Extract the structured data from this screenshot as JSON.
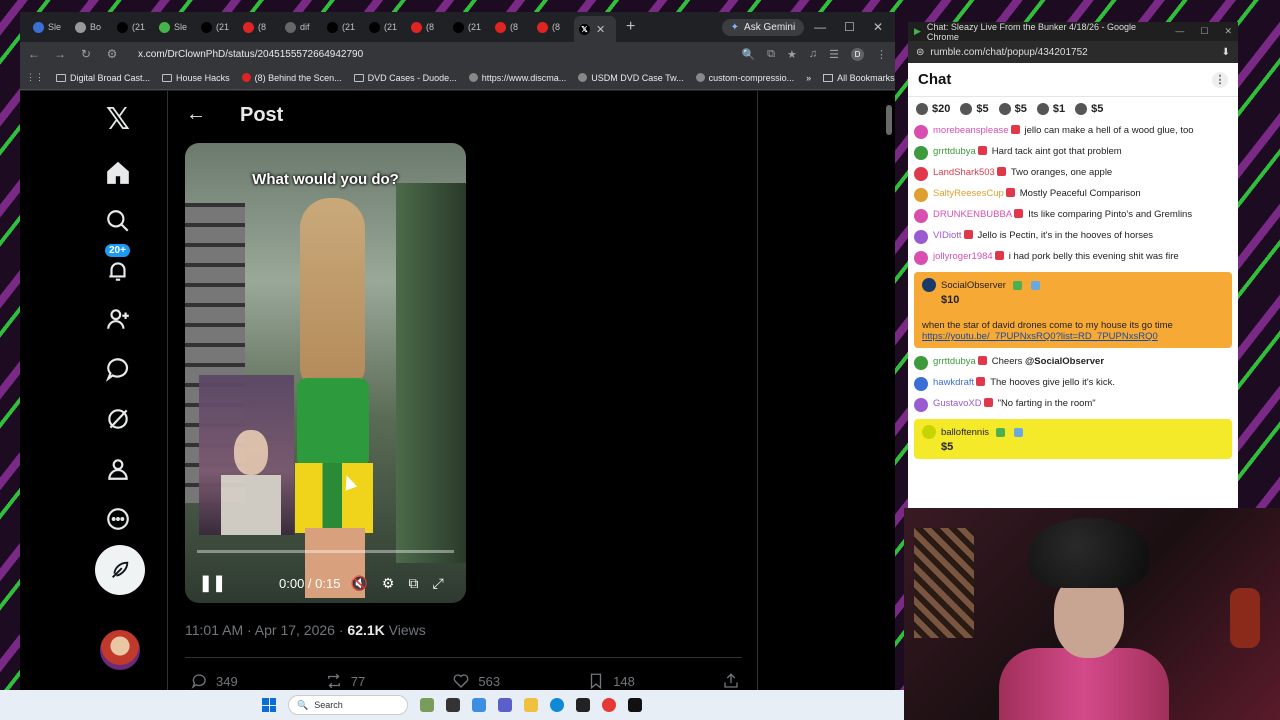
{
  "left_browser": {
    "tabs": [
      {
        "label": "Sle",
        "icon": "rumble-icon",
        "color": "#3b6fd6"
      },
      {
        "label": "Bo",
        "icon": "star-icon",
        "color": "#999999"
      },
      {
        "label": "(21",
        "icon": "x-icon",
        "color": "#000000"
      },
      {
        "label": "Sle",
        "icon": "rumble-icon",
        "color": "#46b34b"
      },
      {
        "label": "(21",
        "icon": "x-icon",
        "color": "#000000"
      },
      {
        "label": "(8",
        "icon": "youtube-icon",
        "color": "#e02424"
      },
      {
        "label": "dif",
        "icon": "web-icon",
        "color": "#666666"
      },
      {
        "label": "(21",
        "icon": "x-icon",
        "color": "#000000"
      },
      {
        "label": "(21",
        "icon": "x-icon",
        "color": "#000000"
      },
      {
        "label": "(8",
        "icon": "youtube-icon",
        "color": "#e02424"
      },
      {
        "label": "(21",
        "icon": "x-icon",
        "color": "#000000"
      },
      {
        "label": "(8",
        "icon": "youtube-icon",
        "color": "#e02424"
      },
      {
        "label": "(8",
        "icon": "youtube-icon",
        "color": "#e02424"
      }
    ],
    "active_tab_icon": "x-icon",
    "ask_gemini": "Ask Gemini",
    "url": "x.com/DrClownPhD/status/2045155572664942790",
    "bookmarks": [
      {
        "label": "Digital Broad Cast...",
        "icon": "folder-icon"
      },
      {
        "label": "House Hacks",
        "icon": "folder-icon"
      },
      {
        "label": "(8) Behind the Scen...",
        "icon": "youtube-icon"
      },
      {
        "label": "DVD Cases - Duode...",
        "icon": "folder-icon"
      },
      {
        "label": "https://www.discma...",
        "icon": "web-icon"
      },
      {
        "label": "USDM DVD Case Tw...",
        "icon": "web-icon"
      },
      {
        "label": "custom-compressio...",
        "icon": "web-icon"
      }
    ],
    "all_bookmarks": "All Bookmarks"
  },
  "x_page": {
    "post_title": "Post",
    "notification_count": "20+",
    "video": {
      "caption": "What would you do?",
      "time": "0:00 / 0:15",
      "progress": 0.0
    },
    "meta": {
      "time": "11:01 AM · Apr 17, 2026 · ",
      "views_count": "62.1K",
      "views_label": " Views"
    },
    "actions": {
      "replies": "349",
      "reposts": "77",
      "likes": "563",
      "bookmarks": "148"
    }
  },
  "chat_window": {
    "window_title": "Chat: Sleazy Live From the Bunker 4/18/26 - Google Chrome",
    "url": "rumble.com/chat/popup/434201752",
    "header": "Chat",
    "rants": [
      "$20",
      "$5",
      "$5",
      "$1",
      "$5"
    ],
    "messages": [
      {
        "user": "morebeansplease",
        "text": "jello can make a hell of a wood glue, too",
        "color": "#d94fb0"
      },
      {
        "user": "grrttdubya",
        "text": "Hard tack aint got that problem",
        "color": "#3d9a3d"
      },
      {
        "user": "LandShark503",
        "text": "Two oranges, one apple",
        "color": "#e0384a"
      },
      {
        "user": "SaltyReesesCup",
        "text": "Mostly Peaceful Comparison",
        "color": "#e0a030"
      },
      {
        "user": "DRUNKENBUBBA",
        "text": "Its like comparing Pinto's and Gremlins",
        "color": "#d94fb0"
      },
      {
        "user": "VIDiott",
        "text": "Jello is Pectin, it's in the hooves of horses",
        "color": "#9a5ad0"
      },
      {
        "user": "jollyroger1984",
        "text": "i had pork belly this evening shit was fire",
        "color": "#d94fb0"
      }
    ],
    "rant1": {
      "user": "SocialObserver",
      "amount": "$10",
      "text": "when the star of david drones come to my house its go time ",
      "link": "https://youtu.be/_7PUPNxsRQ0?list=RD_7PUPNxsRQ0",
      "bg": "#f7a935"
    },
    "messages2": [
      {
        "user": "grrttdubya",
        "text": "Cheers ",
        "mention": "@SocialObserver",
        "color": "#3d9a3d"
      },
      {
        "user": "hawkdraft",
        "text": "The hooves give jello it's kick.",
        "mention": "",
        "color": "#3b6fd6"
      },
      {
        "user": "GustavoXD",
        "text": "\"No farting in the room\"",
        "mention": "",
        "color": "#9a5ad0"
      }
    ],
    "rant2": {
      "user": "balloftennis",
      "amount": "$5",
      "bg": "#f5ea2a"
    }
  },
  "taskbar": {
    "search_placeholder": "Search"
  }
}
